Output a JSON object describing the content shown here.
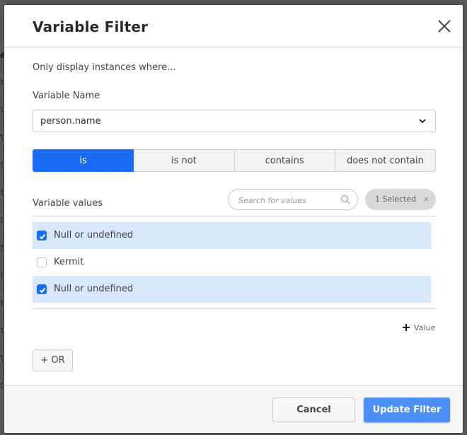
{
  "background": {
    "visible_chars": [
      "e",
      "t",
      "t",
      "t",
      "t",
      "t",
      "t",
      "t",
      "t",
      "t",
      "t",
      "t",
      "t"
    ]
  },
  "modal": {
    "title": "Variable Filter",
    "close_icon": "close-x-icon",
    "intro": "Only display instances where...",
    "variable_name_label": "Variable Name",
    "variable_name_value": "person.name",
    "operators": [
      {
        "label": "is",
        "active": true
      },
      {
        "label": "is not",
        "active": false
      },
      {
        "label": "contains",
        "active": false
      },
      {
        "label": "does not contain",
        "active": false
      }
    ],
    "values_label": "Variable values",
    "search": {
      "placeholder": "Search for values",
      "value": ""
    },
    "selected_pill": {
      "label": "1 Selected",
      "clear_glyph": "×"
    },
    "values": [
      {
        "label": "Null or undefined",
        "checked": true
      },
      {
        "label": "Kermit",
        "checked": false
      },
      {
        "label": "Null or undefined",
        "checked": true
      }
    ],
    "add_value_label": "Value",
    "or_button": "+ OR",
    "footer": {
      "cancel": "Cancel",
      "update": "Update Filter"
    }
  },
  "colors": {
    "accent": "#1a6cf5",
    "primary_button": "#4b8ff7",
    "selected_row": "#d9e7fb",
    "pill_bg": "#d9d9d9"
  }
}
